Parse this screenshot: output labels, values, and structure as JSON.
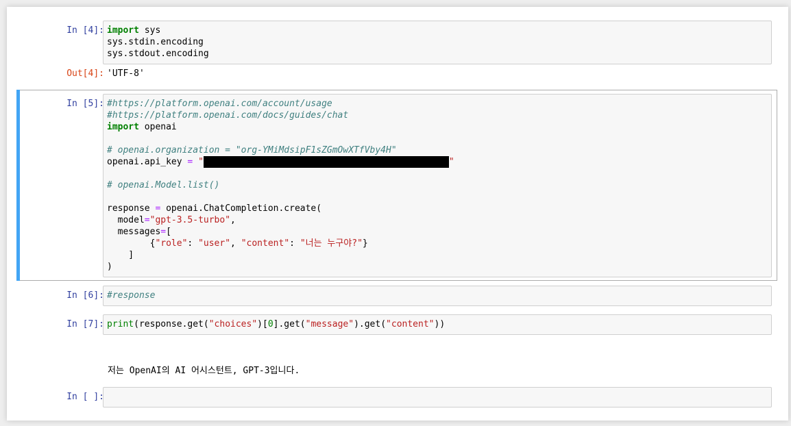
{
  "cells": {
    "c4": {
      "prompt": "In [4]:",
      "lines": [
        {
          "kw": "import",
          "rest": " sys"
        },
        {
          "text": "sys.stdin.encoding"
        },
        {
          "text": "sys.stdout.encoding"
        }
      ],
      "out_prompt": "Out[4]:",
      "output": "'UTF-8'"
    },
    "c5": {
      "prompt": "In [5]:",
      "comment_usage": "#https://platform.openai.com/account/usage",
      "comment_docs": "#https://platform.openai.com/docs/guides/chat",
      "import_kw": "import",
      "import_rest": " openai",
      "comment_org": "# openai.organization = \"org-YMiMdsipF1sZGmOwXTfVby4H\"",
      "api_key_prefix": "openai.api_key ",
      "eq": "=",
      "quote": "\"",
      "comment_model": "# openai.Model.list()",
      "response_var": "response ",
      "create_call": " openai.ChatCompletion.create(",
      "model_kw": "  model",
      "model_val": "\"gpt-3.5-turbo\"",
      "comma": ",",
      "messages_kw": "  messages",
      "bracket_open": "[",
      "msg_indent": "        {",
      "role_key": "\"role\"",
      "colon_sp": ": ",
      "role_val": "\"user\"",
      "sep": ", ",
      "content_key": "\"content\"",
      "content_val": "\"너는 누구야?\"",
      "brace_close": "}",
      "bracket_close": "    ]",
      "paren_close": ")"
    },
    "c6": {
      "prompt": "In [6]:",
      "comment": "#response"
    },
    "c7": {
      "prompt": "In [7]:",
      "print_fn": "print",
      "p1": "(response.get(",
      "s_choices": "\"choices\"",
      "p2": ")[",
      "num0": "0",
      "p3": "].get(",
      "s_message": "\"message\"",
      "p4": ").get(",
      "s_content": "\"content\"",
      "p5": "))",
      "output": "저는 OpenAI의 AI 어시스턴트, GPT-3입니다."
    },
    "c8": {
      "prompt": "In [ ]:"
    }
  }
}
